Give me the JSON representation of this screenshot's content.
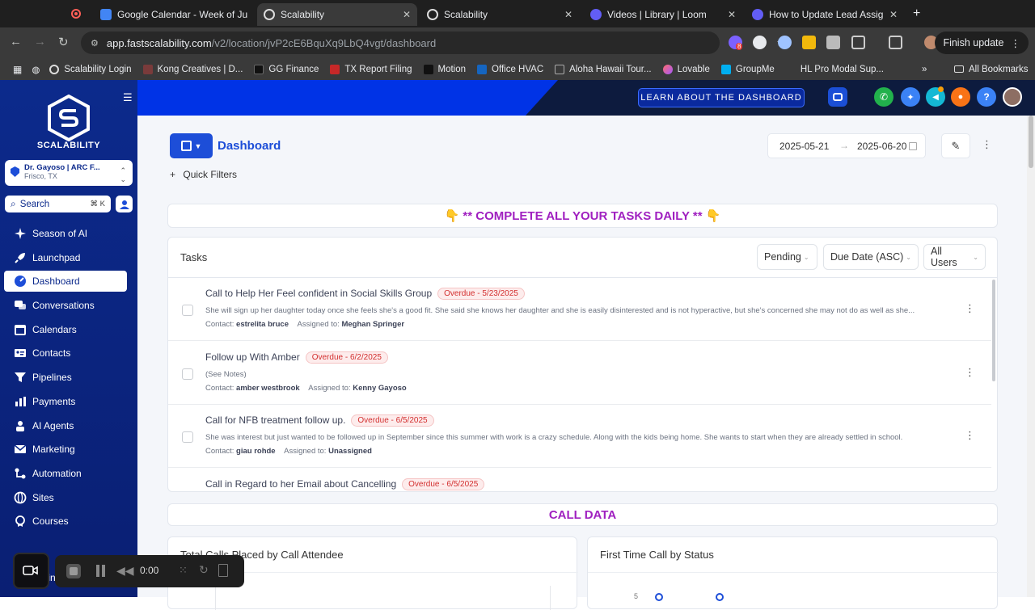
{
  "browser": {
    "tabs": [
      {
        "title": "Google Calendar - Week of Ju",
        "active": false
      },
      {
        "title": "Scalability",
        "active": true
      },
      {
        "title": "Scalability",
        "active": false
      },
      {
        "title": "Videos | Library | Loom",
        "active": false
      },
      {
        "title": "How to Update Lead Assignm",
        "active": false
      }
    ],
    "url_host": "app.fastscalability.com",
    "url_path": "/v2/location/jvP2cE6BquXq9LbQ4vgt/dashboard",
    "ext_badge": "8",
    "finish_update": "Finish update",
    "bookmarks": [
      "Scalability Login",
      "Kong Creatives | D...",
      "GG Finance",
      "TX Report Filing",
      "Motion",
      "Office HVAC",
      "Aloha Hawaii Tour...",
      "Lovable",
      "GroupMe",
      "HL Pro Modal Sup..."
    ],
    "all_bookmarks": "All Bookmarks"
  },
  "header": {
    "learn_button": "LEARN ABOUT THE DASHBOARD",
    "help": "?"
  },
  "sidebar": {
    "brand": "SCALABILITY",
    "location_name": "Dr. Gayoso | ARC F...",
    "location_city": "Frisco, TX",
    "search_label": "Search",
    "search_kbd": "⌘ K",
    "items": [
      {
        "label": "Season of AI"
      },
      {
        "label": "Launchpad"
      },
      {
        "label": "Dashboard"
      },
      {
        "label": "Conversations"
      },
      {
        "label": "Calendars"
      },
      {
        "label": "Contacts"
      },
      {
        "label": "Pipelines"
      },
      {
        "label": "Payments"
      },
      {
        "label": "AI Agents"
      },
      {
        "label": "Marketing"
      },
      {
        "label": "Automation"
      },
      {
        "label": "Sites"
      },
      {
        "label": "Courses"
      }
    ],
    "partial_item": "tin"
  },
  "dashboard": {
    "title": "Dashboard",
    "date_start": "2025-05-21",
    "date_end": "2025-06-20",
    "quick_filters": "Quick Filters",
    "banner": "👇 ** COMPLETE ALL YOUR TASKS DAILY ** 👇",
    "tasks_title": "Tasks",
    "filter_status": "Pending",
    "filter_sort": "Due Date (ASC)",
    "filter_users": "All Users",
    "tasks": [
      {
        "title": "Call to Help Her Feel confident in Social Skills Group",
        "due": "Overdue - 5/23/2025",
        "desc": "She will sign up her daughter today once she feels she's a good fit. She said she knows her daughter and she is easily disinterested and is not hyperactive, but she's concerned she may not do as well as she...",
        "contact_label": "Contact:",
        "contact": "estrelita bruce",
        "assigned_label": "Assigned to:",
        "assigned": "Meghan Springer"
      },
      {
        "title": "Follow up With Amber",
        "due": "Overdue - 6/2/2025",
        "desc": "(See Notes)",
        "contact_label": "Contact:",
        "contact": "amber westbrook",
        "assigned_label": "Assigned to:",
        "assigned": "Kenny Gayoso"
      },
      {
        "title": "Call for NFB treatment follow up.",
        "due": "Overdue - 6/5/2025",
        "desc": "She was interest but just wanted to be followed up in September since this summer with work is a crazy schedule. Along with the kids being home. She wants to start when they are already settled in school.",
        "contact_label": "Contact:",
        "contact": "giau rohde",
        "assigned_label": "Assigned to:",
        "assigned": "Unassigned"
      },
      {
        "title": "Call in Regard to her Email about Cancelling",
        "due": "Overdue - 6/5/2025",
        "desc": "",
        "contact_label": "",
        "contact": "",
        "assigned_label": "",
        "assigned": ""
      }
    ],
    "call_data_title": "CALL DATA",
    "panel_left_title": "Total Calls Placed by Call Attendee",
    "panel_right_title": "First Time Call by Status",
    "panel_right_tick": "5"
  },
  "recorder": {
    "time": "0:00"
  }
}
